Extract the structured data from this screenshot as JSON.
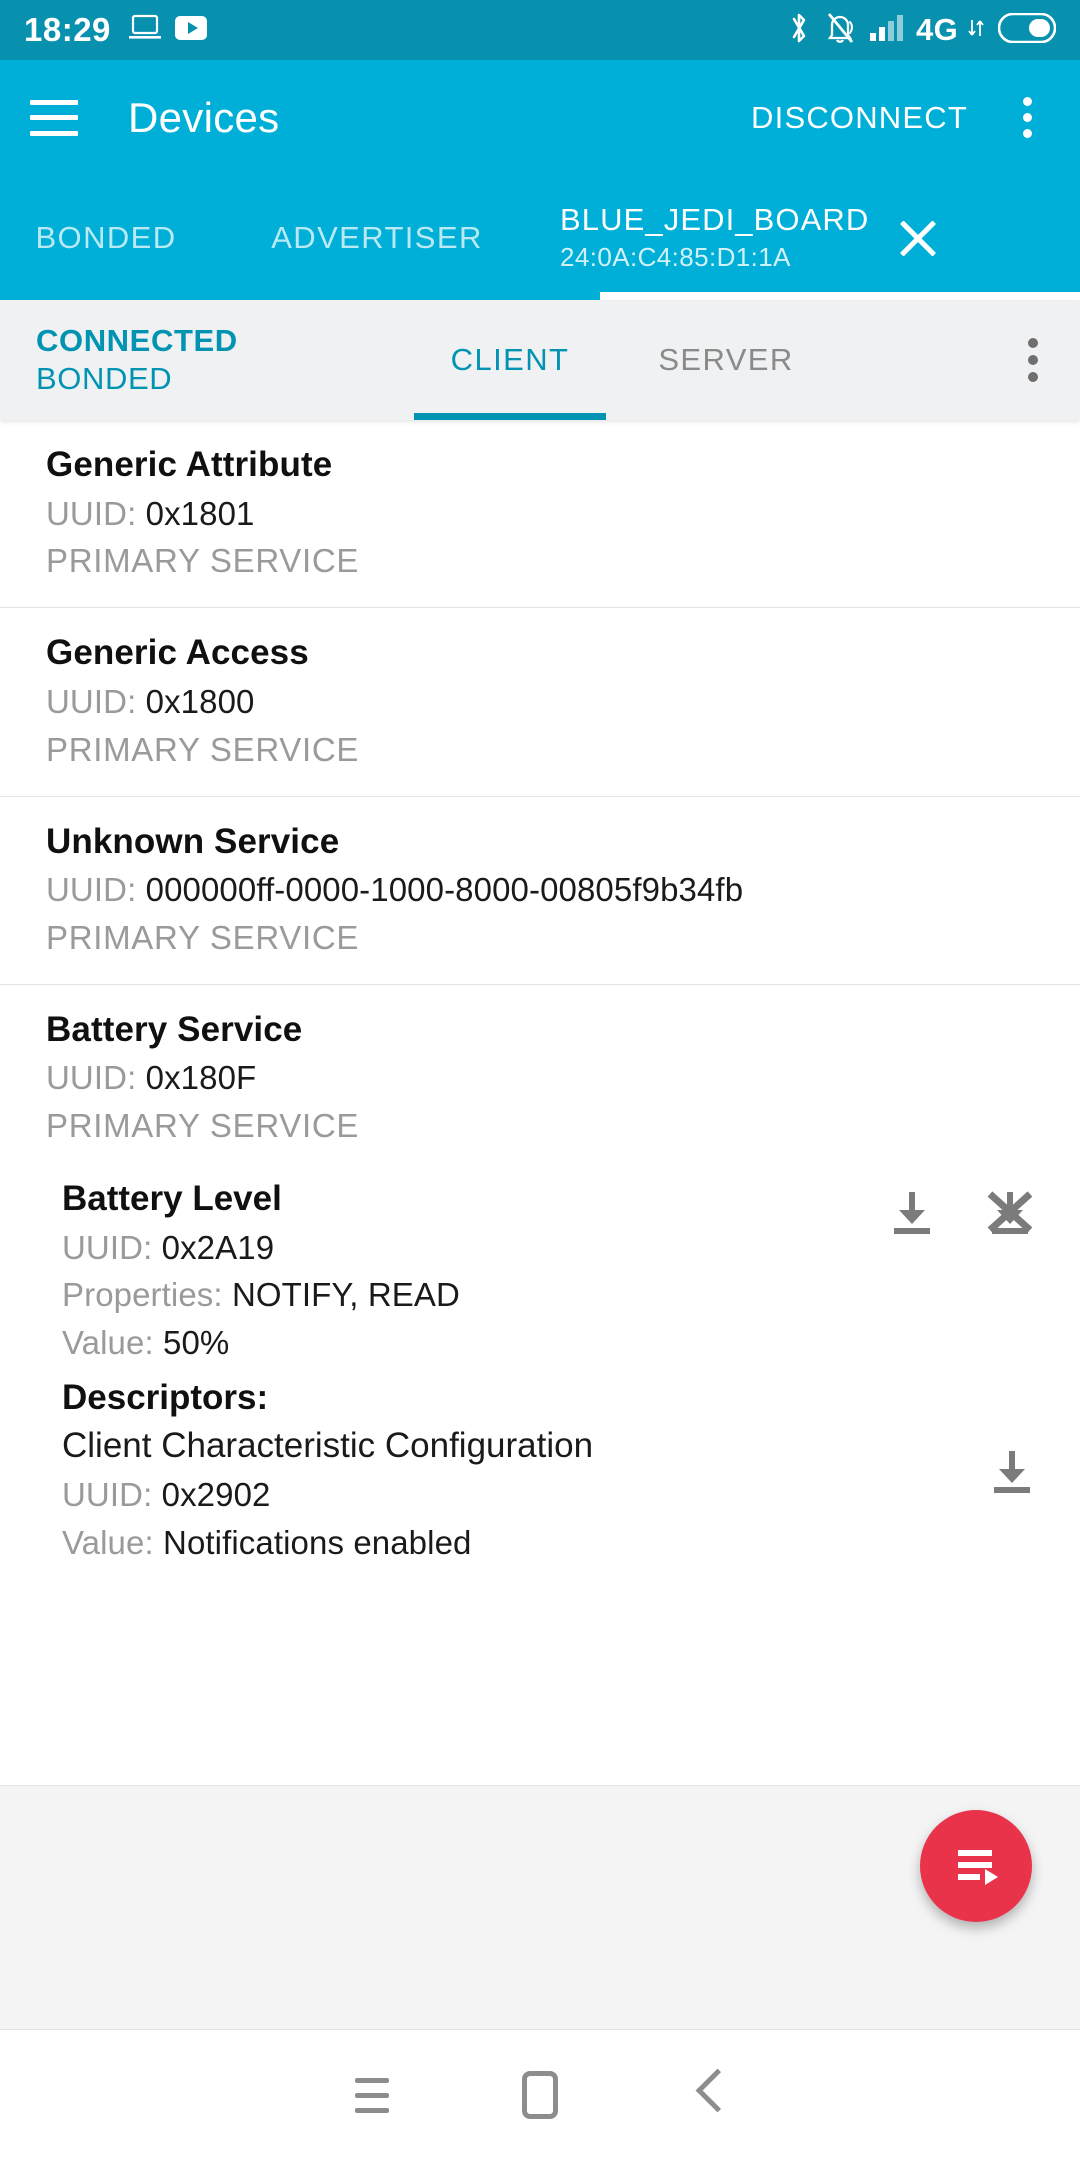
{
  "statusbar": {
    "clock": "18:29",
    "icons_left": [
      "laptop-icon",
      "youtube-icon"
    ],
    "icons_right": [
      "bluetooth-icon",
      "notifications-muted-icon",
      "signal-bars-icon",
      "network-type-label",
      "data-transfer-icon",
      "battery-icon"
    ],
    "network_type": "4G"
  },
  "appbar": {
    "menu_icon": "hamburger-menu-icon",
    "title": "Devices",
    "disconnect_label": "DISCONNECT",
    "overflow_icon": "kebab-menu-icon"
  },
  "tabs": {
    "items": [
      {
        "label": "BONDED",
        "active": false
      },
      {
        "label": "ADVERTISER",
        "active": false
      }
    ],
    "device_tab": {
      "name": "BLUE_JEDI_BOARD",
      "address": "24:0A:C4:85:D1:1A",
      "close_icon": "close-icon",
      "active": true
    }
  },
  "subheader": {
    "connection_state": "CONNECTED",
    "bond_state": "BONDED",
    "subtabs": [
      {
        "label": "CLIENT",
        "active": true
      },
      {
        "label": "SERVER",
        "active": false
      }
    ],
    "overflow_icon": "kebab-menu-icon"
  },
  "labels": {
    "uuid": "UUID:",
    "properties": "Properties:",
    "value": "Value:",
    "descriptors": "Descriptors:",
    "primary_service": "PRIMARY SERVICE"
  },
  "services": [
    {
      "name": "Generic Attribute",
      "uuid": "0x1801",
      "type": "PRIMARY SERVICE"
    },
    {
      "name": "Generic Access",
      "uuid": "0x1800",
      "type": "PRIMARY SERVICE"
    },
    {
      "name": "Unknown Service",
      "uuid": "000000ff-0000-1000-8000-00805f9b34fb",
      "type": "PRIMARY SERVICE"
    },
    {
      "name": "Battery Service",
      "uuid": "0x180F",
      "type": "PRIMARY SERVICE"
    }
  ],
  "characteristic": {
    "name": "Battery Level",
    "uuid": "0x2A19",
    "properties": "NOTIFY, READ",
    "value": "50%",
    "read_icon": "read-download-icon",
    "notify_off_icon": "notifications-disable-icon"
  },
  "descriptor": {
    "heading": "Descriptors:",
    "name": "Client Characteristic Configuration",
    "uuid": "0x2902",
    "value": "Notifications enabled",
    "read_icon": "read-download-icon"
  },
  "fab": {
    "icon": "playlist-play-icon",
    "color": "#e8334a"
  },
  "navbar": {
    "items": [
      "recents-icon",
      "home-icon",
      "back-icon"
    ]
  },
  "colors": {
    "status_bar": "#0791AE",
    "app_bar": "#00AFD7",
    "accent_teal": "#0093B2",
    "fab_red": "#e8334a",
    "subheader_bg": "#eff1f2"
  }
}
